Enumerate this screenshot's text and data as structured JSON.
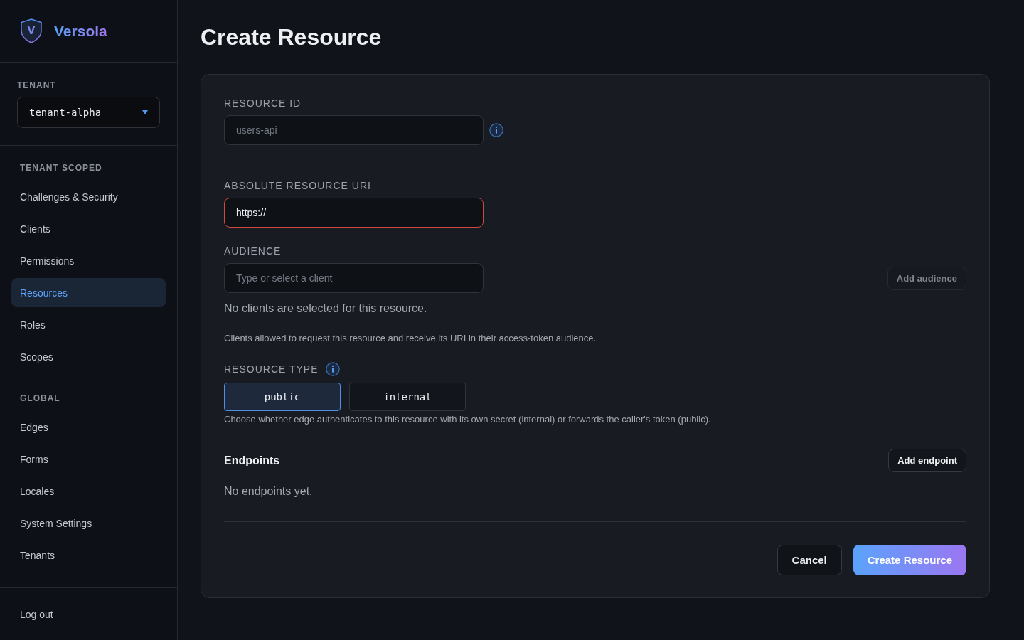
{
  "sidebar": {
    "brand": {
      "mark": "V",
      "name": "Versola"
    },
    "tenant": {
      "label": "TENANT",
      "value": "tenant-alpha"
    },
    "nav_sections": [
      {
        "heading": "TENANT SCOPED",
        "items": [
          {
            "label": "Challenges & Security",
            "selected": false
          },
          {
            "label": "Clients",
            "selected": false
          },
          {
            "label": "Permissions",
            "selected": false
          },
          {
            "label": "Resources",
            "selected": true
          },
          {
            "label": "Roles",
            "selected": false
          },
          {
            "label": "Scopes",
            "selected": false
          }
        ]
      },
      {
        "heading": "GLOBAL",
        "items": [
          {
            "label": "Edges",
            "selected": false
          },
          {
            "label": "Forms",
            "selected": false
          },
          {
            "label": "Locales",
            "selected": false
          },
          {
            "label": "System Settings",
            "selected": false
          },
          {
            "label": "Tenants",
            "selected": false
          }
        ]
      }
    ],
    "logout": "Log out"
  },
  "page": {
    "title": "Create Resource"
  },
  "form": {
    "resource_id": {
      "label": "RESOURCE ID",
      "placeholder": "users-api"
    },
    "resource_uri": {
      "label": "ABSOLUTE RESOURCE URI",
      "value": "https://",
      "invalid": true
    },
    "audience": {
      "label": "AUDIENCE",
      "placeholder": "Type or select a client",
      "add_button": {
        "label": "Add audience",
        "disabled": true
      },
      "empty_message": "No clients are selected for this resource.",
      "help": "Clients allowed to request this resource and receive its URI in their access-token audience."
    },
    "resource_type": {
      "label": "RESOURCE TYPE",
      "options": [
        {
          "label": "public",
          "selected": true
        },
        {
          "label": "internal",
          "selected": false
        }
      ],
      "help": "Choose whether edge authenticates to this resource with its own secret (internal) or forwards the caller's token (public)."
    },
    "endpoints": {
      "title": "Endpoints",
      "add_button": {
        "label": "Add endpoint",
        "disabled": false
      },
      "empty_message": "No endpoints yet."
    },
    "actions": [
      {
        "label": "Cancel",
        "kind": "secondary"
      },
      {
        "label": "Create Resource",
        "kind": "primary"
      }
    ]
  }
}
